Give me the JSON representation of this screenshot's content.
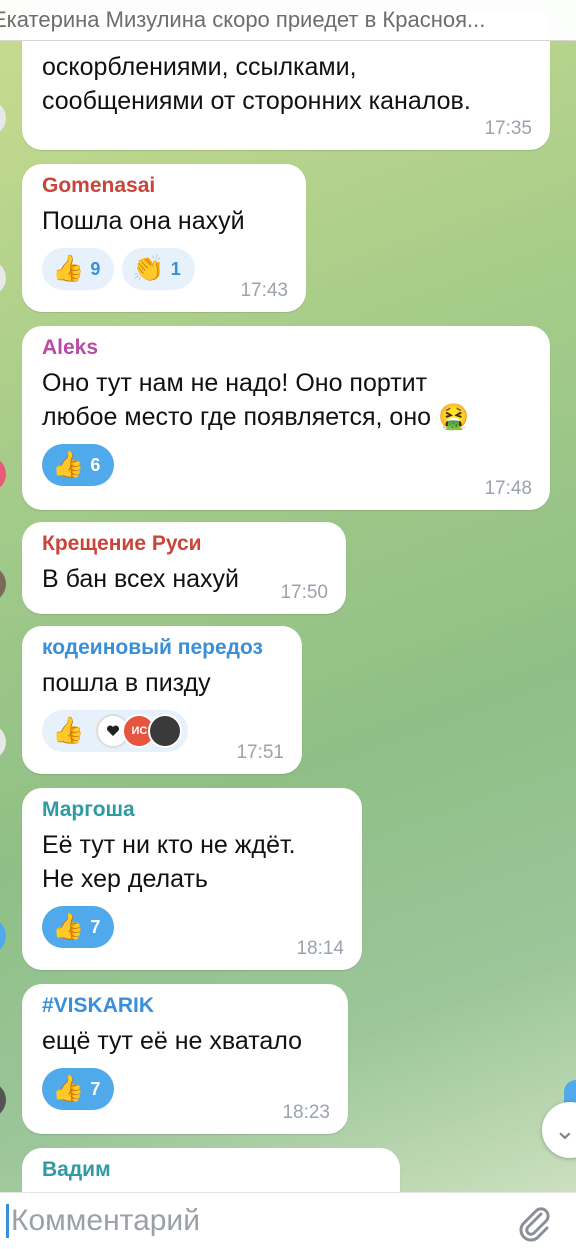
{
  "header": {
    "title": "Екатерина Мизулина скоро приедет в Красноя..."
  },
  "messages": [
    {
      "text": "оскорблениями, ссылками,\nсообщениями от сторонних каналов.",
      "time": "17:35"
    },
    {
      "author": "Gomenasai",
      "author_color": "#c9453a",
      "text": "Пошла она нахуй",
      "time": "17:43",
      "reactions": [
        {
          "emoji": "👍",
          "count": "9"
        },
        {
          "emoji": "👏",
          "count": "1"
        }
      ]
    },
    {
      "author": "Aleks",
      "author_color": "#b84aa6",
      "text": "Оно тут нам не надо! Оно портит\nлюбое место где появляется, оно 🤮",
      "time": "17:48",
      "reactions": [
        {
          "emoji": "👍",
          "count": "6"
        }
      ]
    },
    {
      "author": "Крещение Руси",
      "author_color": "#c9453a",
      "text": "В бан всех нахуй",
      "time": "17:50"
    },
    {
      "author": "кодеиновый передоз",
      "author_color": "#3a8fd8",
      "text": "пошла в пизду",
      "time": "17:51",
      "reactions": [
        {
          "emoji": "👍"
        }
      ],
      "reaction_avatar_text": "ИС"
    },
    {
      "author": "Маргоша",
      "author_color": "#2f9aa3",
      "text": "Её тут ни кто не ждёт.\nНе хер делать",
      "time": "18:14",
      "reactions": [
        {
          "emoji": "👍",
          "count": "7"
        }
      ]
    },
    {
      "author": "#VISKARIK",
      "author_color": "#3a8fd8",
      "text": "ещё тут её не хватало",
      "time": "18:23",
      "reactions": [
        {
          "emoji": "👍",
          "count": "7"
        }
      ]
    },
    {
      "author": "Вадим",
      "author_color": "#2f9aa3"
    }
  ],
  "input": {
    "placeholder": "Комментарий"
  },
  "icons": {
    "attach": "paperclip-icon",
    "scroll_down": "chevron-down-icon"
  },
  "colors": {
    "accent": "#4fa9ea",
    "bubble": "#ffffff"
  }
}
